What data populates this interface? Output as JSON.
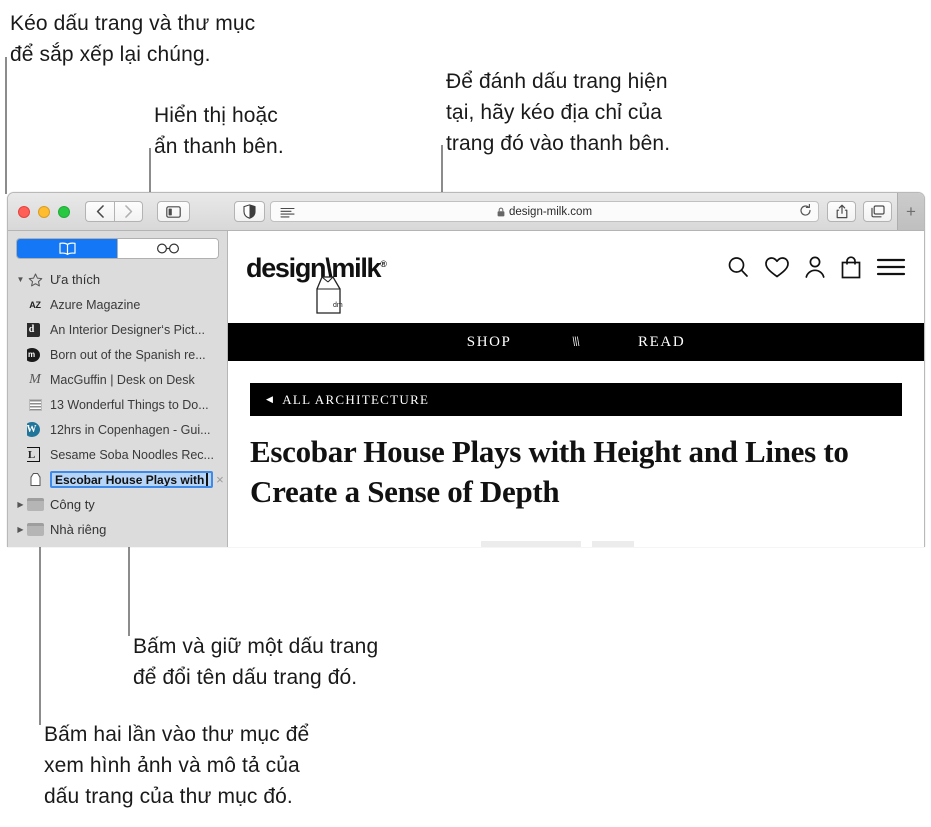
{
  "callouts": [
    {
      "id": "reorder",
      "text": "Kéo dấu trang và thư mục\nđể sắp xếp lại chúng."
    },
    {
      "id": "sidebar",
      "text": "Hiển thị hoặc\nẩn thanh bên."
    },
    {
      "id": "bookmark",
      "text": "Để đánh dấu trang hiện\ntại, hãy kéo địa chỉ của\ntrang đó vào thanh bên."
    },
    {
      "id": "rename",
      "text": "Bấm và giữ một dấu trang\nđể đổi tên dấu trang đó."
    },
    {
      "id": "openfolder",
      "text": "Bấm hai lần vào thư mục để\nxem hình ảnh và mô tả của\ndấu trang của thư mục đó."
    }
  ],
  "window": {
    "toolbar": {
      "back_label": "‹",
      "forward_label": "›",
      "sidebar_toggle_name": "sidebar-icon",
      "shield_name": "shield-icon",
      "reader_name": "reader-view-icon",
      "lock_glyph": "🔒",
      "url": "design-milk.com",
      "reload_glyph": "↻",
      "share_name": "share-icon",
      "tab_overview_name": "tab-overview-icon",
      "new_tab_label": "+"
    },
    "sidebar": {
      "tabs": [
        {
          "id": "bookmarks",
          "icon": "book-icon",
          "active": true
        },
        {
          "id": "reading-list",
          "icon": "glasses-icon",
          "active": false
        }
      ],
      "favorites_group": "Ưa thích",
      "bookmarks": [
        {
          "label": "Azure Magazine",
          "favicon": "az"
        },
        {
          "label": "An Interior Designer‘s Pict...",
          "favicon": "d"
        },
        {
          "label": "Born out of the Spanish re...",
          "favicon": "m"
        },
        {
          "label": "MacGuffin | Desk on Desk",
          "favicon": "macguffin"
        },
        {
          "label": "13 Wonderful Things to Do...",
          "favicon": "grid"
        },
        {
          "label": "12hrs in Copenhagen - Gui...",
          "favicon": "wordpress"
        },
        {
          "label": "Sesame Soba Noodles Rec...",
          "favicon": "l"
        }
      ],
      "editing_bookmark": {
        "value": "Escobar House Plays with",
        "favicon": "carton",
        "delete_label": "×"
      },
      "folders": [
        {
          "label": "Công ty"
        },
        {
          "label": "Nhà riêng"
        }
      ]
    },
    "page": {
      "logo_text": "design\\milk",
      "logo_registered": "®",
      "carton_label": "dm",
      "nav_icons": [
        "search-icon",
        "heart-icon",
        "person-icon",
        "bag-icon",
        "menu-icon"
      ],
      "nav_links": [
        {
          "label": "SHOP"
        },
        {
          "label": "\\\\\\"
        },
        {
          "label": "READ"
        }
      ],
      "category_back_glyph": "◀",
      "category_label": "ALL ARCHITECTURE",
      "headline": "Escobar House Plays with Height and Lines to Create a Sense of Depth"
    }
  },
  "colors": {
    "accent_blue": "#1477f5",
    "selection_blue": "#b6d4f7",
    "leader_gray": "#8c8c8c",
    "black": "#000000"
  }
}
